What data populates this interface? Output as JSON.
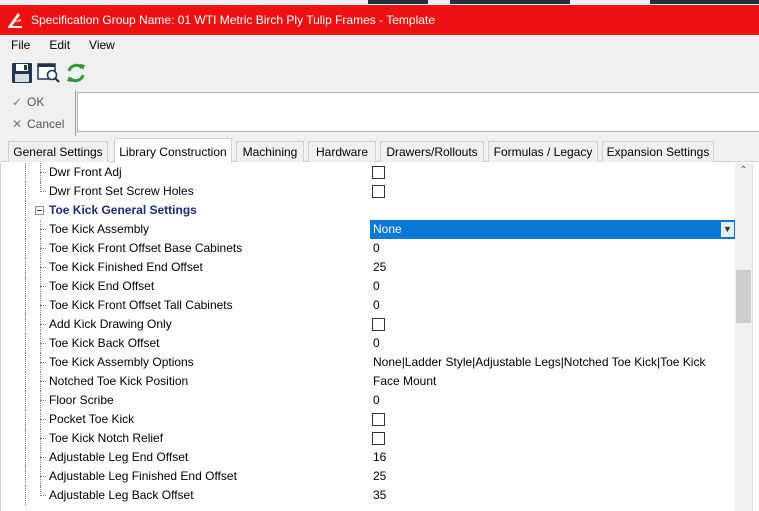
{
  "window": {
    "title": "Specification Group Name: 01 WTI Metric Birch Ply  Tulip Frames - Template",
    "brand_color": "#ee1111",
    "logo_icon": "app-logo-icon"
  },
  "menu": {
    "items": [
      {
        "label": "File"
      },
      {
        "label": "Edit"
      },
      {
        "label": "View"
      }
    ]
  },
  "toolbar": {
    "save_icon": "save-icon",
    "preview_icon": "print-preview-icon",
    "refresh_icon": "refresh-icon"
  },
  "actions": {
    "ok_label": "OK",
    "cancel_label": "Cancel"
  },
  "tabs": [
    {
      "label": "General Settings",
      "active": false
    },
    {
      "label": "Library Construction",
      "active": true
    },
    {
      "label": "Machining",
      "active": false
    },
    {
      "label": "Hardware",
      "active": false
    },
    {
      "label": "Drawers/Rollouts",
      "active": false
    },
    {
      "label": "Formulas / Legacy",
      "active": false
    },
    {
      "label": "Expansion Settings",
      "active": false
    }
  ],
  "grid": {
    "rows": [
      {
        "label": "Dwr Front Adj",
        "type": "checkbox",
        "checked": false
      },
      {
        "label": "Dwr Front Set Screw Holes",
        "type": "checkbox",
        "checked": false
      },
      {
        "label": "Toe Kick General Settings",
        "type": "group"
      },
      {
        "label": "Toe Kick Assembly",
        "type": "combo",
        "value": "None"
      },
      {
        "label": "Toe Kick Front Offset Base Cabinets",
        "type": "text",
        "value": "0"
      },
      {
        "label": "Toe Kick Finished End Offset",
        "type": "text",
        "value": "25"
      },
      {
        "label": "Toe Kick End Offset",
        "type": "text",
        "value": "0"
      },
      {
        "label": "Toe Kick Front Offset Tall Cabinets",
        "type": "text",
        "value": "0"
      },
      {
        "label": "Add Kick Drawing Only",
        "type": "checkbox",
        "checked": false
      },
      {
        "label": "Toe Kick Back Offset",
        "type": "text",
        "value": "0"
      },
      {
        "label": "Toe Kick Assembly Options",
        "type": "text",
        "value": "None|Ladder Style|Adjustable Legs|Notched Toe Kick|Toe Kick"
      },
      {
        "label": "Notched Toe Kick Position",
        "type": "text",
        "value": "Face Mount"
      },
      {
        "label": "Floor Scribe",
        "type": "text",
        "value": "0"
      },
      {
        "label": "Pocket Toe Kick",
        "type": "checkbox",
        "checked": false
      },
      {
        "label": "Toe Kick Notch Relief",
        "type": "checkbox",
        "checked": false
      },
      {
        "label": "Adjustable Leg End Offset",
        "type": "text",
        "value": "16"
      },
      {
        "label": "Adjustable Leg Finished End Offset",
        "type": "text",
        "value": "25"
      },
      {
        "label": "Adjustable Leg Back Offset",
        "type": "text",
        "value": "35"
      }
    ]
  }
}
